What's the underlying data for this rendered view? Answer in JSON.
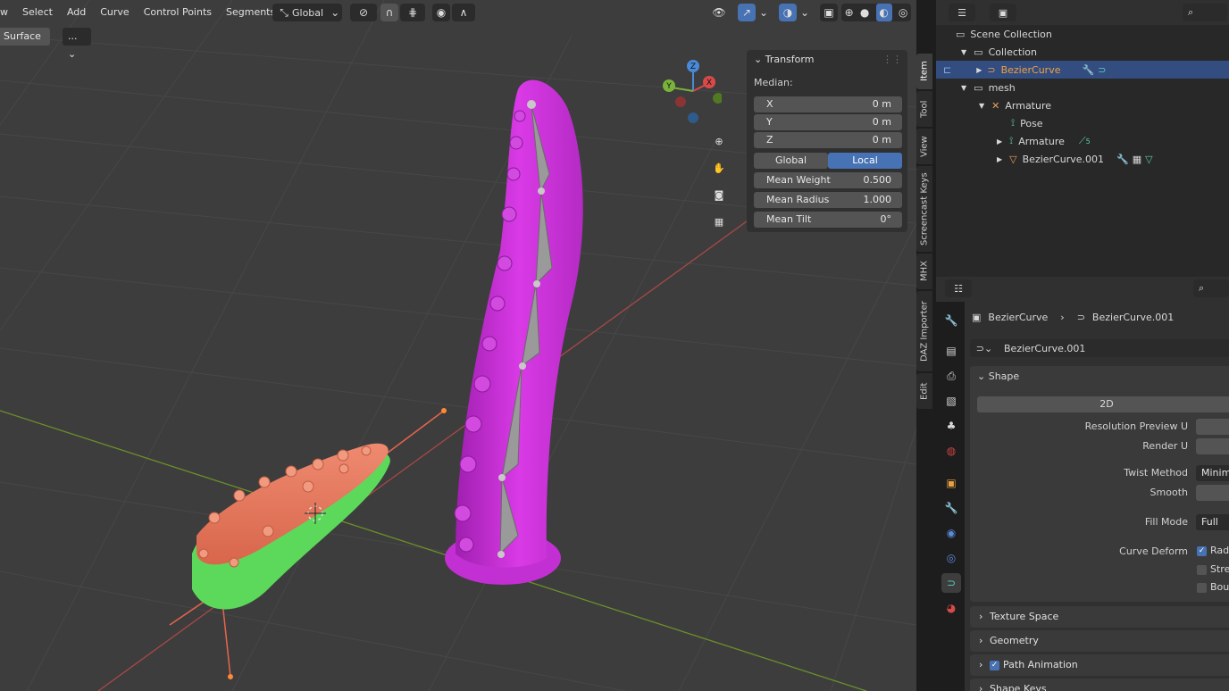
{
  "viewport": {
    "menu": [
      "w",
      "Select",
      "Add",
      "Curve",
      "Control Points",
      "Segments"
    ],
    "orientation": "Global",
    "mode_chip": "Surface",
    "mode_dropdown": "...",
    "gizmo": {
      "x": "X",
      "y": "Y",
      "z": "Z"
    }
  },
  "npanel": {
    "title": "Transform",
    "median_label": "Median:",
    "x_label": "X",
    "x_value": "0 m",
    "y_label": "Y",
    "y_value": "0 m",
    "z_label": "Z",
    "z_value": "0 m",
    "global": "Global",
    "local": "Local",
    "mean_weight_label": "Mean Weight",
    "mean_weight": "0.500",
    "mean_radius_label": "Mean Radius",
    "mean_radius": "1.000",
    "mean_tilt_label": "Mean Tilt",
    "mean_tilt": "0°"
  },
  "side_tabs": [
    "Item",
    "Tool",
    "View",
    "Screencast Keys",
    "MHX",
    "DAZ Importer",
    "Edit"
  ],
  "outliner": {
    "scene_collection": "Scene Collection",
    "collection": "Collection",
    "beziercurve": "BezierCurve",
    "mesh": "mesh",
    "armature": "Armature",
    "pose": "Pose",
    "armature_data": "Armature",
    "bone_count": "5",
    "beziercurve001": "BezierCurve.001"
  },
  "properties": {
    "breadcrumb_object": "BezierCurve",
    "breadcrumb_data": "BezierCurve.001",
    "datablock": "BezierCurve.001",
    "shape_section": "Shape",
    "mode_2d": "2D",
    "resolution_preview_u": "Resolution Preview U",
    "render_u": "Render U",
    "twist_method": "Twist Method",
    "twist_value": "Minim",
    "smooth": "Smooth",
    "fill_mode": "Fill Mode",
    "fill_value": "Full",
    "curve_deform": "Curve Deform",
    "rad": "Rad",
    "stre": "Stre",
    "bou": "Bou",
    "texture_space": "Texture Space",
    "geometry": "Geometry",
    "path_animation": "Path Animation",
    "shape_keys": "Shape Keys"
  },
  "colors": {
    "selection_blue": "#4772b3",
    "magenta_object": "#cc33dd",
    "orange_object": "#e87a5e",
    "green_object": "#5dd35a"
  }
}
